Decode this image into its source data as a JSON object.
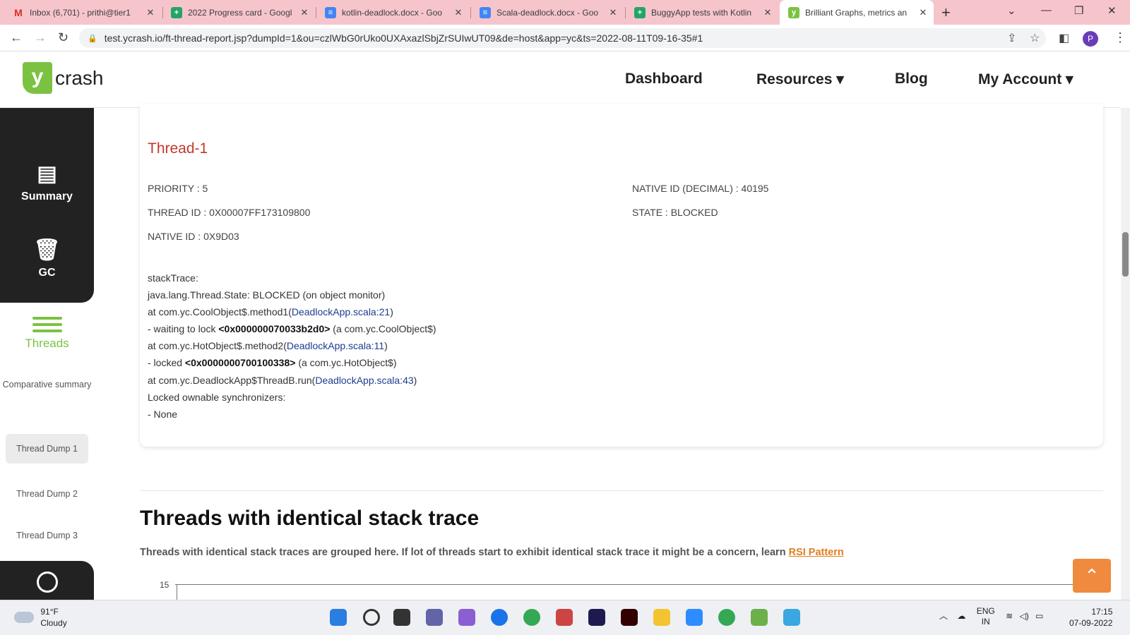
{
  "browser": {
    "tabs": [
      {
        "label": "Inbox (6,701) - prithi@tier1",
        "icon": "gmail-icon"
      },
      {
        "label": "2022 Progress card - Googl",
        "icon": "sheets-icon"
      },
      {
        "label": "kotlin-deadlock.docx - Goo",
        "icon": "docs-icon"
      },
      {
        "label": "Scala-deadlock.docx - Goo",
        "icon": "docs-icon"
      },
      {
        "label": "BuggyApp tests with Kotlin",
        "icon": "sheets-icon"
      },
      {
        "label": "Brilliant Graphs, metrics an",
        "icon": "ycrash-icon"
      }
    ],
    "url": "test.ycrash.io/ft-thread-report.jsp?dumpId=1&ou=czlWbG0rUko0UXAxazlSbjZrSUIwUT09&de=host&app=yc&ts=2022-08-11T09-16-35#1",
    "profile_initial": "P"
  },
  "site": {
    "logo_letter": "y",
    "logo_word": "crash",
    "nav": {
      "dashboard": "Dashboard",
      "resources": "Resources ▾",
      "blog": "Blog",
      "account": "My Account ▾"
    }
  },
  "sidebar": {
    "summary": "Summary",
    "gc": "GC",
    "threads": "Threads",
    "comparative": "Comparative summary",
    "dumps": [
      "Thread Dump 1",
      "Thread Dump 2",
      "Thread Dump 3"
    ]
  },
  "thread": {
    "name": "Thread-1",
    "priority": "PRIORITY : 5",
    "thread_id": "THREAD ID : 0X00007FF173109800",
    "native_id": "NATIVE ID : 0X9D03",
    "native_id_decimal": "NATIVE ID (DECIMAL) : 40195",
    "state": "STATE : BLOCKED",
    "stack_label": "stackTrace:",
    "stack": {
      "l1": "java.lang.Thread.State: BLOCKED (on object monitor)",
      "l2_pre": "at com.yc.CoolObject$.method1(",
      "l2_link": "DeadlockApp.scala:21",
      "l3_pre": "- waiting to lock ",
      "l3_bold": "<0x000000070033b2d0>",
      "l3_post": " (a com.yc.CoolObject$)",
      "l4_pre": "at com.yc.HotObject$.method2(",
      "l4_link": "DeadlockApp.scala:11",
      "l5_pre": "- locked ",
      "l5_bold": "<0x0000000700100338>",
      "l5_post": " (a com.yc.HotObject$)",
      "l6_pre": "at com.yc.DeadlockApp$ThreadB.run(",
      "l6_link": "DeadlockApp.scala:43",
      "l7": "Locked ownable synchronizers:",
      "l8": "- None",
      "close": ")"
    }
  },
  "identical": {
    "title": "Threads with identical stack trace",
    "desc": "Threads with identical stack traces are grouped here. If lot of threads start to exhibit identical stack trace it might be a concern, learn ",
    "link": "RSI Pattern",
    "chart_y_tick": "15"
  },
  "taskbar": {
    "temp": "91°F",
    "condition": "Cloudy",
    "lang1": "ENG",
    "lang2": "IN",
    "time": "17:15",
    "date": "07-09-2022"
  }
}
